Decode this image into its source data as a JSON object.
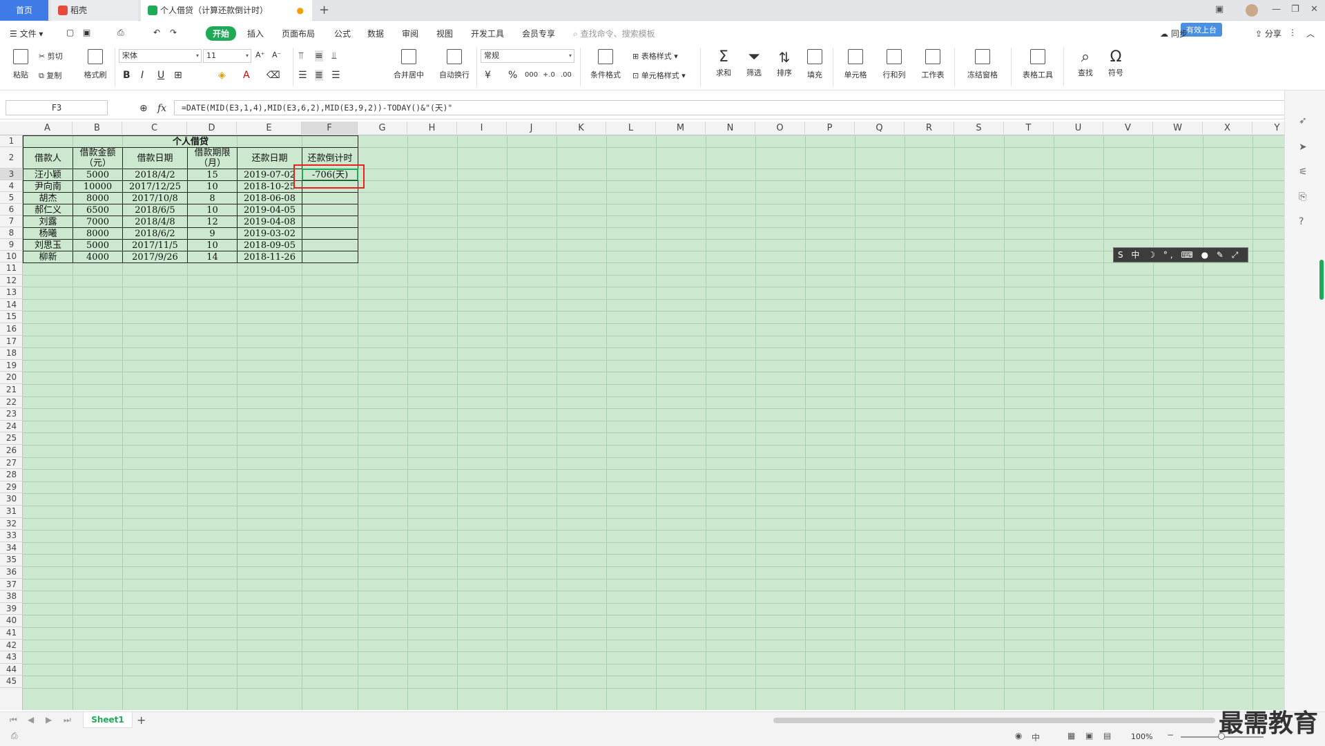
{
  "titlebar": {
    "home_tab": "首页",
    "doc_tab": "稻壳",
    "active_tab": "个人借贷（计算还款倒计时）",
    "new_tab": "+"
  },
  "menubar": {
    "file": "文件",
    "items": [
      "开始",
      "插入",
      "页面布局",
      "公式",
      "数据",
      "审阅",
      "视图",
      "开发工具",
      "会员专享"
    ],
    "search_placeholder": "查找命令、搜索模板",
    "sync": "同步",
    "share": "分享",
    "cloud_badge": "有效上台"
  },
  "ribbon": {
    "paste": "粘贴",
    "cut": "剪切",
    "copy": "复制",
    "format_painter": "格式刷",
    "font_name": "宋体",
    "font_size": "11",
    "merge_center": "合并居中",
    "wrap_text": "自动换行",
    "number_format": "常规",
    "currency": "¥",
    "percent": "%",
    "thousands": "000",
    "conditional_format": "条件格式",
    "table_style": "表格样式",
    "cell_style": "单元格样式",
    "sum": "求和",
    "filter": "筛选",
    "sort": "排序",
    "fill": "填充",
    "cell": "单元格",
    "row_col": "行和列",
    "worksheet": "工作表",
    "freeze": "冻结窗格",
    "table_tools": "表格工具",
    "find": "查找",
    "symbol": "符号"
  },
  "formula_bar": {
    "name_box": "F3",
    "fx": "fx",
    "formula": "=DATE(MID(E3,1,4),MID(E3,6,2),MID(E3,9,2))-TODAY()&\"(天)\""
  },
  "columns": [
    "A",
    "B",
    "C",
    "D",
    "E",
    "F",
    "G",
    "H",
    "I",
    "J",
    "K",
    "L",
    "M",
    "N",
    "O",
    "P",
    "Q",
    "R",
    "S",
    "T",
    "U",
    "V",
    "W",
    "X",
    "Y"
  ],
  "rows": [
    "1",
    "2",
    "3",
    "4",
    "5",
    "6",
    "7",
    "8",
    "9",
    "10",
    "11",
    "12",
    "13",
    "14",
    "15",
    "16",
    "17",
    "18",
    "19",
    "20",
    "21",
    "22",
    "23",
    "24",
    "25",
    "26",
    "27",
    "28",
    "29",
    "30",
    "31",
    "32",
    "33",
    "34",
    "35",
    "36",
    "37",
    "38",
    "39",
    "40",
    "41",
    "42",
    "43",
    "44",
    "45"
  ],
  "table": {
    "title": "个人借贷",
    "headers": [
      "借款人",
      "借款金额（元）",
      "借款日期",
      "借款期限（月）",
      "还款日期",
      "还款倒计时"
    ],
    "rows": [
      [
        "汪小颖",
        "5000",
        "2018/4/2",
        "15",
        "2019-07-02",
        "-706(天)"
      ],
      [
        "尹向南",
        "10000",
        "2017/12/25",
        "10",
        "2018-10-25",
        ""
      ],
      [
        "胡杰",
        "8000",
        "2017/10/8",
        "8",
        "2018-06-08",
        ""
      ],
      [
        "郝仁义",
        "6500",
        "2018/6/5",
        "10",
        "2019-04-05",
        ""
      ],
      [
        "刘露",
        "7000",
        "2018/4/8",
        "12",
        "2019-04-08",
        ""
      ],
      [
        "杨曦",
        "8000",
        "2018/6/2",
        "9",
        "2019-03-02",
        ""
      ],
      [
        "刘思玉",
        "5000",
        "2017/11/5",
        "10",
        "2018-09-05",
        ""
      ],
      [
        "柳新",
        "4000",
        "2017/9/26",
        "14",
        "2018-11-26",
        ""
      ]
    ]
  },
  "sheet_tab": "Sheet1",
  "status": {
    "zoom": "100%",
    "ime_state": "中"
  },
  "ime_bar": "S 中 ☽ °, ⌨ ● ✎ ⤢",
  "watermark": "最需教育",
  "colors": {
    "accent_green": "#1faa58",
    "grid_bg": "#cce8cf",
    "highlight_red": "#e8201f",
    "home_tab_blue": "#3e7be6"
  }
}
